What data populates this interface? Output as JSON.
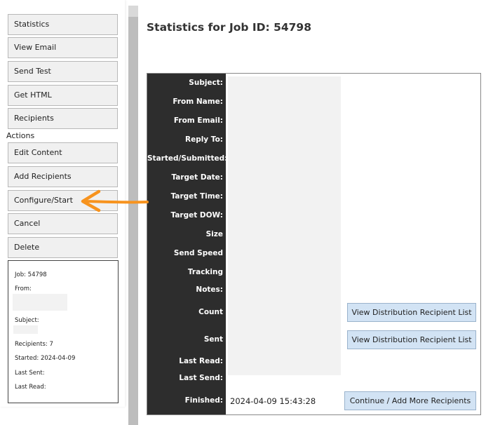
{
  "sidebar": {
    "menu": [
      {
        "label": "Statistics"
      },
      {
        "label": "View Email"
      },
      {
        "label": "Send Test"
      },
      {
        "label": "Get HTML"
      },
      {
        "label": "Recipients"
      }
    ],
    "actions_heading": "Actions",
    "actions": [
      {
        "label": "Edit Content"
      },
      {
        "label": "Add Recipients"
      },
      {
        "label": "Configure/Start"
      },
      {
        "label": "Cancel"
      },
      {
        "label": "Delete"
      }
    ],
    "info": {
      "job": "Job: 54798",
      "from": "From:",
      "subject": "Subject:",
      "recipients": "Recipients: 7",
      "started": "Started: 2024-04-09",
      "last_sent": "Last Sent:",
      "last_read": "Last Read:"
    }
  },
  "page": {
    "title": "Statistics for Job ID: 54798"
  },
  "stats": {
    "labels": {
      "subject": "Subject:",
      "from_name": "From Name:",
      "from_email": "From Email:",
      "reply_to": "Reply To:",
      "started": "Started/Submitted:",
      "target_date": "Target Date:",
      "target_time": "Target Time:",
      "target_dow": "Target DOW:",
      "size": "Size",
      "send_speed": "Send Speed",
      "tracking": "Tracking",
      "notes": "Notes:",
      "count": "Count",
      "sent": "Sent",
      "last_read": "Last Read:",
      "last_send": "Last Send:",
      "finished": "Finished:"
    },
    "finished_value": "2024-04-09 15:43:28",
    "view_list_label": "View Distribution Recipient List",
    "continue_label": "Continue / Add More Recipients"
  },
  "colors": {
    "label_column_bg": "#2d2d2d",
    "button_blue": "#d2e3f4",
    "arrow_orange": "#f7931e"
  },
  "icons": {
    "pointer": "arrow-left-icon"
  }
}
